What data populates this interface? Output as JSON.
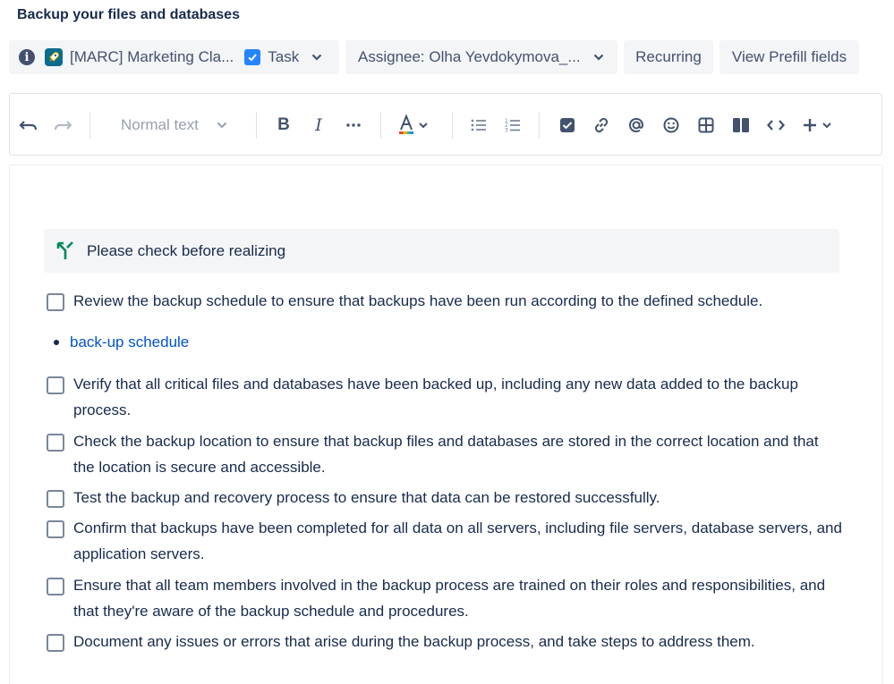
{
  "page_title": "Backup your files and databases",
  "header": {
    "project": "[MARC] Marketing Cla...",
    "issue_type": "Task",
    "assignee": "Assignee: Olha Yevdokymova_...",
    "recurring": "Recurring",
    "prefill": "View Prefill fields"
  },
  "toolbar": {
    "text_style": "Normal text"
  },
  "panel": {
    "text": "Please check before realizing"
  },
  "tasks": [
    {
      "text": "Review the backup schedule to ensure that backups have been run according to the defined schedule."
    },
    {
      "text": "Verify that all critical files and databases have been backed up, including any new data added to the backup process."
    },
    {
      "text": "Check the backup location to ensure that backup files and databases are stored in the correct location and that the location is secure and accessible."
    },
    {
      "text": "Test the backup and recovery process to ensure that data can be restored successfully."
    },
    {
      "text": "Confirm that backups have been completed for all data on all servers, including file servers, database servers, and application servers."
    },
    {
      "text": "Ensure that all team members involved in the backup process are trained on their roles and responsibilities, and that they're aware of the backup schedule and procedures."
    },
    {
      "text": "Document any issues or errors that arise during the backup process, and take steps to address them."
    }
  ],
  "bullet_link": "back-up schedule",
  "colors": {
    "link": "#0052cc",
    "text": "#172b4d",
    "icon": "#42526e",
    "decision": "#00875a",
    "task_blue": "#2684ff"
  }
}
